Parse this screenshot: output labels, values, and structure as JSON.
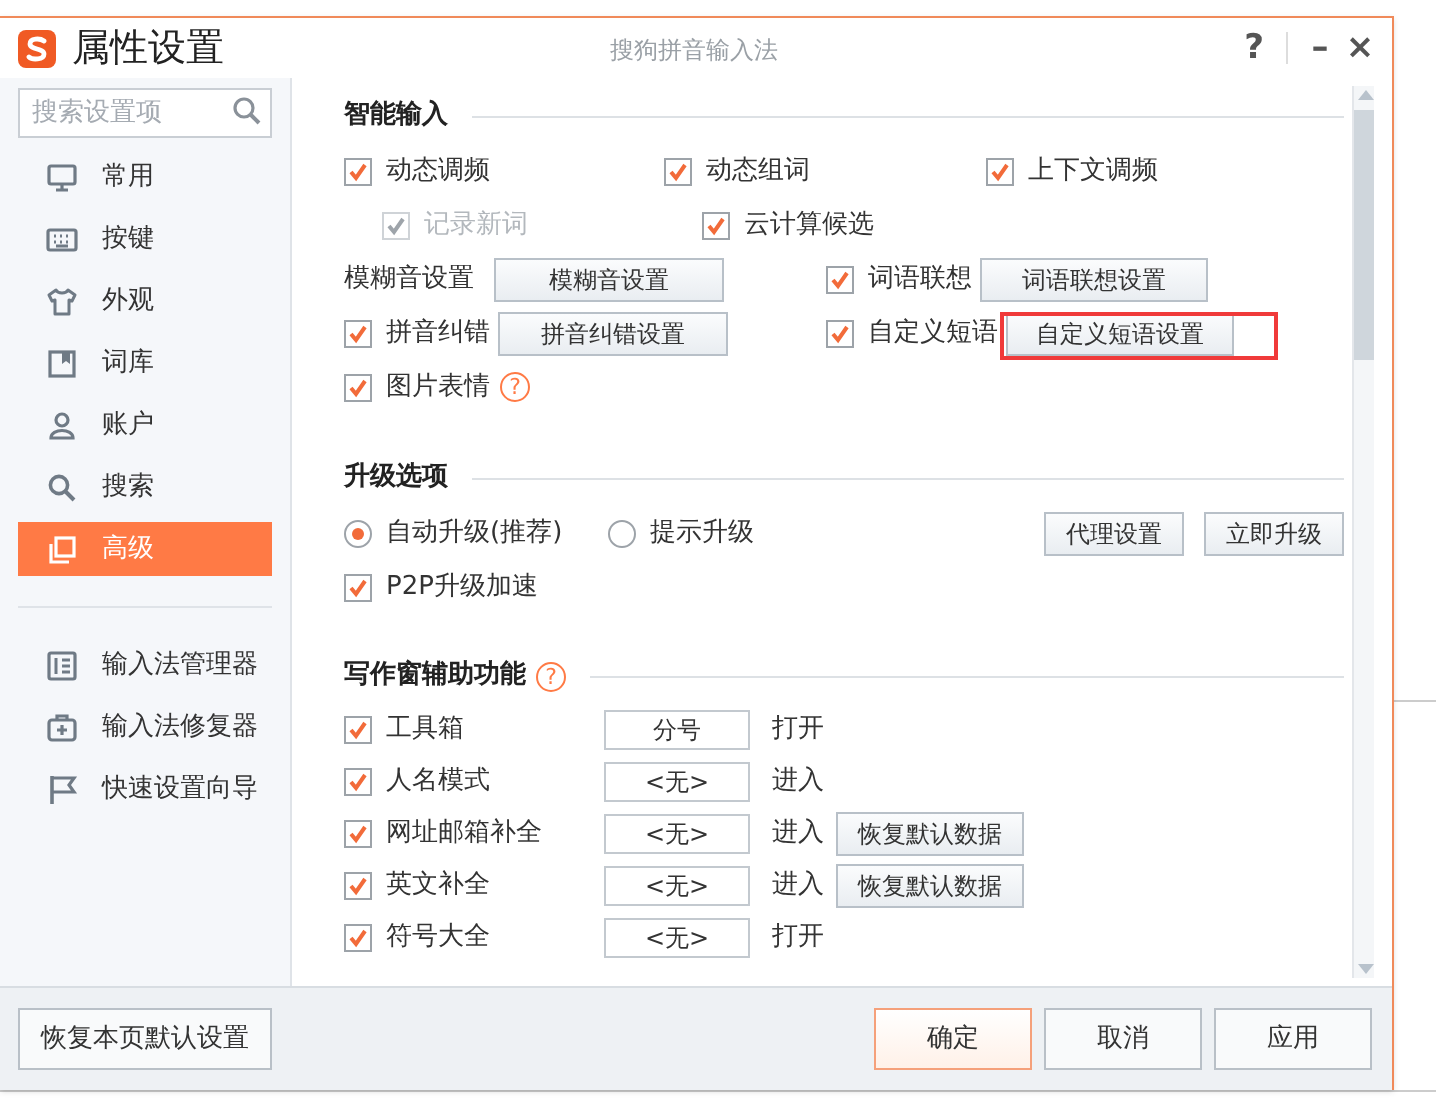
{
  "window": {
    "title": "属性设置",
    "app_name": "搜狗拼音输入法",
    "controls": [
      "?",
      "–",
      "×"
    ]
  },
  "sidebar": {
    "search": {
      "placeholder": "搜索设置项"
    },
    "items": [
      {
        "label": "常用",
        "selected": false
      },
      {
        "label": "按键",
        "selected": false
      },
      {
        "label": "外观",
        "selected": false
      },
      {
        "label": "词库",
        "selected": false
      },
      {
        "label": "账户",
        "selected": false
      },
      {
        "label": "搜索",
        "selected": false
      },
      {
        "label": "高级",
        "selected": true
      }
    ],
    "tools": [
      {
        "label": "输入法管理器"
      },
      {
        "label": "输入法修复器"
      },
      {
        "label": "快速设置向导"
      }
    ]
  },
  "sections": [
    {
      "title": "智能输入",
      "rows": [
        {
          "kind": "grid3",
          "cells": [
            [
              {
                "kind": "checkbox",
                "label": "动态调频",
                "checked": true,
                "disabled": false
              }
            ],
            [
              {
                "kind": "checkbox",
                "label": "动态组词",
                "checked": true,
                "disabled": false
              }
            ],
            [
              {
                "kind": "checkbox",
                "label": "上下文调频",
                "checked": true,
                "disabled": false
              }
            ]
          ]
        },
        {
          "kind": "sub3",
          "cells": [
            [
              {
                "kind": "checkbox",
                "label": "记录新词",
                "checked": true,
                "disabled": true
              }
            ],
            [
              {
                "kind": "checkbox",
                "label": "云计算候选",
                "checked": true,
                "disabled": false
              }
            ]
          ]
        },
        {
          "kind": "pair",
          "cells": [
            [
              {
                "kind": "label",
                "label": "模糊音设置"
              },
              {
                "kind": "button",
                "label": "模糊音设置"
              }
            ],
            [
              {
                "kind": "checkbox",
                "label": "词语联想",
                "checked": true,
                "disabled": false
              },
              {
                "kind": "button",
                "label": "词语联想设置"
              }
            ]
          ]
        },
        {
          "kind": "pair",
          "cells": [
            [
              {
                "kind": "checkbox",
                "label": "拼音纠错",
                "checked": true,
                "disabled": false
              },
              {
                "kind": "button",
                "label": "拼音纠错设置"
              }
            ],
            [
              {
                "kind": "checkbox",
                "label": "自定义短语",
                "checked": true,
                "disabled": false
              },
              {
                "kind": "button",
                "label": "自定义短语设置"
              }
            ]
          ]
        },
        {
          "kind": "single",
          "cells": [
            [
              {
                "kind": "checkbox",
                "label": "图片表情",
                "checked": true,
                "disabled": false
              },
              {
                "kind": "help",
                "label": "?"
              }
            ]
          ]
        }
      ]
    },
    {
      "title": "升级选项",
      "rows": [
        {
          "kind": "radios",
          "cells": [
            [
              {
                "kind": "radio",
                "label": "自动升级(推荐)",
                "selected": true
              }
            ],
            [
              {
                "kind": "radio",
                "label": "提示升级",
                "selected": false
              }
            ],
            [
              {
                "kind": "button",
                "label": "代理设置"
              },
              {
                "kind": "button",
                "label": "立即升级"
              }
            ]
          ]
        },
        {
          "kind": "single",
          "cells": [
            [
              {
                "kind": "checkbox",
                "label": "P2P升级加速",
                "checked": true,
                "disabled": false
              }
            ]
          ]
        }
      ]
    },
    {
      "title": "写作窗辅助功能",
      "help": "?",
      "rows": [
        {
          "kind": "tool",
          "cells": [
            [
              {
                "kind": "checkbox",
                "label": "工具箱",
                "checked": true,
                "disabled": false
              }
            ],
            [
              {
                "kind": "field",
                "value": "分号"
              }
            ],
            [
              {
                "kind": "text",
                "label": "打开"
              }
            ]
          ]
        },
        {
          "kind": "tool",
          "cells": [
            [
              {
                "kind": "checkbox",
                "label": "人名模式",
                "checked": true,
                "disabled": false
              }
            ],
            [
              {
                "kind": "field",
                "value": "<无>"
              }
            ],
            [
              {
                "kind": "text",
                "label": "进入"
              }
            ]
          ]
        },
        {
          "kind": "tool",
          "cells": [
            [
              {
                "kind": "checkbox",
                "label": "网址邮箱补全",
                "checked": true,
                "disabled": false
              }
            ],
            [
              {
                "kind": "field",
                "value": "<无>"
              }
            ],
            [
              {
                "kind": "text",
                "label": "进入"
              },
              {
                "kind": "button",
                "label": "恢复默认数据"
              }
            ]
          ]
        },
        {
          "kind": "tool",
          "cells": [
            [
              {
                "kind": "checkbox",
                "label": "英文补全",
                "checked": true,
                "disabled": false
              }
            ],
            [
              {
                "kind": "field",
                "value": "<无>"
              }
            ],
            [
              {
                "kind": "text",
                "label": "进入"
              },
              {
                "kind": "button",
                "label": "恢复默认数据"
              }
            ]
          ]
        },
        {
          "kind": "tool",
          "cells": [
            [
              {
                "kind": "checkbox",
                "label": "符号大全",
                "checked": true,
                "disabled": false
              }
            ],
            [
              {
                "kind": "field",
                "value": "<无>"
              }
            ],
            [
              {
                "kind": "text",
                "label": "打开"
              }
            ]
          ]
        }
      ]
    }
  ],
  "footer": {
    "reset": "恢复本页默认设置",
    "buttons": [
      {
        "label": "确定",
        "primary": true
      },
      {
        "label": "取消",
        "primary": false
      },
      {
        "label": "应用",
        "primary": false
      }
    ]
  }
}
